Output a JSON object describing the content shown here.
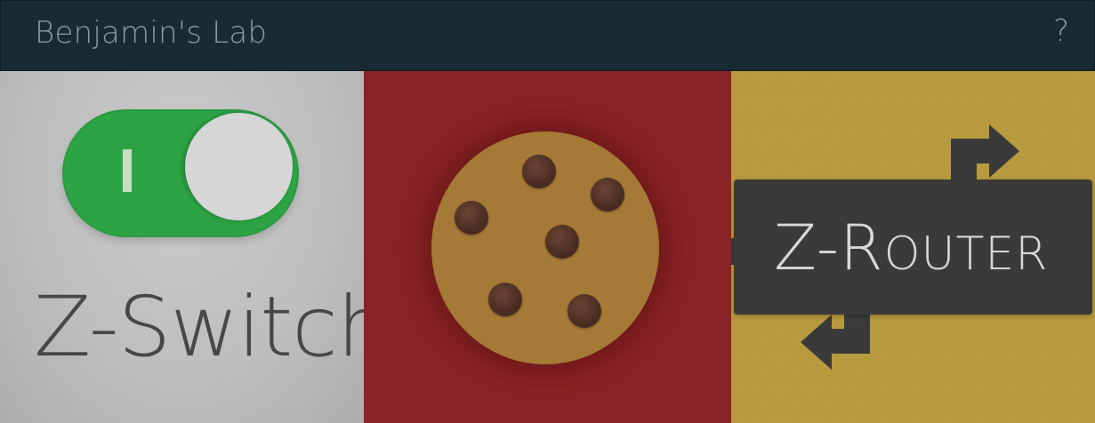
{
  "header": {
    "title": "Benjamin's Lab",
    "help_label": "?"
  },
  "panels": {
    "switch": {
      "title": "Z-Switch",
      "toggle_mark": "I",
      "toggle_state": "on",
      "accent": "#2ca444"
    },
    "cookie": {
      "label": "",
      "accent": "#8a2325"
    },
    "router": {
      "title_initial": "Z-R",
      "title_rest": "OUTER",
      "accent": "#b89a3e"
    }
  },
  "icons": {
    "help": "question-mark",
    "cookie": "cookie-icon",
    "router": "router-arrows-icon"
  }
}
